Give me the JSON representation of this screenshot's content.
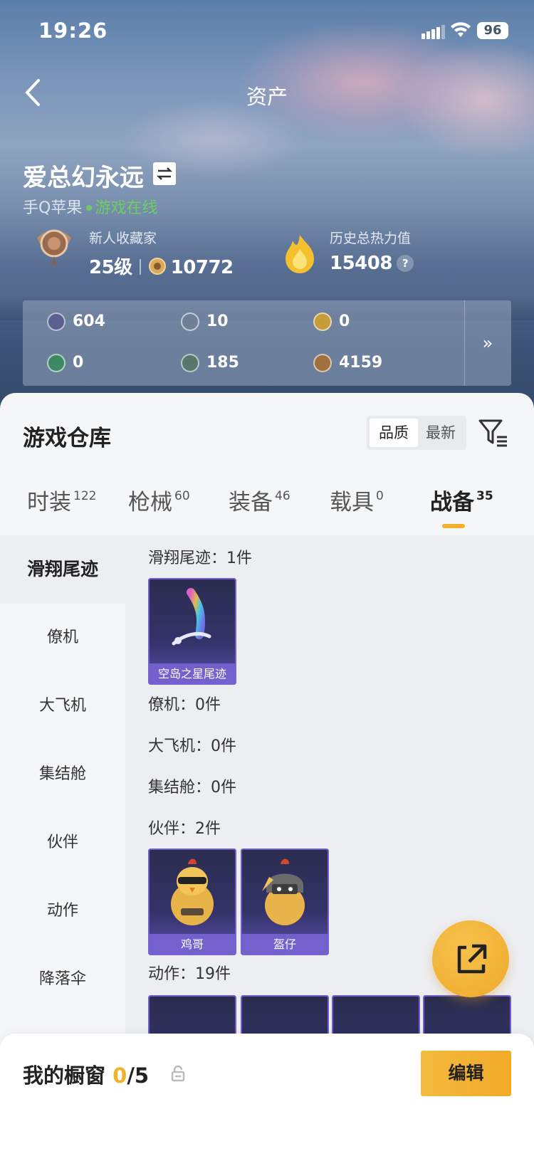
{
  "status_bar": {
    "time": "19:26",
    "battery": "96"
  },
  "nav": {
    "title": "资产"
  },
  "profile": {
    "name": "爱总幻永远",
    "platform": "手Q苹果",
    "online_status": "游戏在线",
    "collector": {
      "label": "新人收藏家",
      "level": "25级",
      "points": "10772"
    },
    "heat": {
      "label": "历史总热力值",
      "value": "15408",
      "help": "?"
    }
  },
  "currencies": [
    {
      "value": "604",
      "color": "#5b5f8f"
    },
    {
      "value": "10",
      "color": "#6f8096"
    },
    {
      "value": "0",
      "color": "#c79a3a"
    },
    {
      "value": "0",
      "color": "#3b8a63"
    },
    {
      "value": "185",
      "color": "#55776e"
    },
    {
      "value": "4159",
      "color": "#a2703e"
    }
  ],
  "currency_more": "»",
  "warehouse": {
    "title": "游戏仓库",
    "sort_options": [
      "品质",
      "最新"
    ],
    "tabs": [
      {
        "label": "时装",
        "count": "122"
      },
      {
        "label": "枪械",
        "count": "60"
      },
      {
        "label": "装备",
        "count": "46"
      },
      {
        "label": "载具",
        "count": "0"
      },
      {
        "label": "战备",
        "count": "35"
      }
    ],
    "active_tab": "战备",
    "categories": [
      "滑翔尾迹",
      "僚机",
      "大飞机",
      "集结舱",
      "伙伴",
      "动作",
      "降落伞"
    ],
    "sections": [
      {
        "label": "滑翔尾迹：1件",
        "items": [
          "空岛之星尾迹"
        ]
      },
      {
        "label": "僚机：0件"
      },
      {
        "label": "大飞机：0件"
      },
      {
        "label": "集结舱：0件"
      },
      {
        "label": "伙伴：2件",
        "items": [
          "鸡哥",
          "盔仔"
        ]
      },
      {
        "label": "动作：19件"
      }
    ]
  },
  "showcase": {
    "label": "我的橱窗",
    "count": "0",
    "total": "/5",
    "edit": "编辑"
  },
  "colors": {
    "accent": "#f2b12b",
    "online": "#6ccd63"
  }
}
